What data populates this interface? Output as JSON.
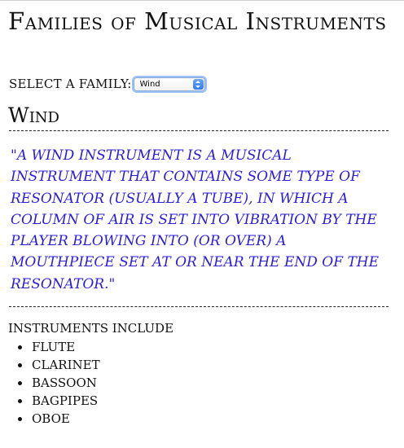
{
  "page": {
    "title": "Families of Musical Instruments"
  },
  "selector": {
    "label": "Select a family:",
    "selected_value": "Wind",
    "accent_color": "#3b82f0"
  },
  "family": {
    "name": "Wind",
    "description": "\"A wind instrument is a musical instrument that contains some type of resonator (usually a tube), in which a column of air is set into vibration by the player blowing into (or over) a mouthpiece set at or near the end of the resonator.\"",
    "description_color": "#2a1ed9"
  },
  "instruments": {
    "heading": "Instruments include",
    "items": [
      "Flute",
      "Clarinet",
      "Bassoon",
      "Bagpipes",
      "Oboe"
    ]
  }
}
